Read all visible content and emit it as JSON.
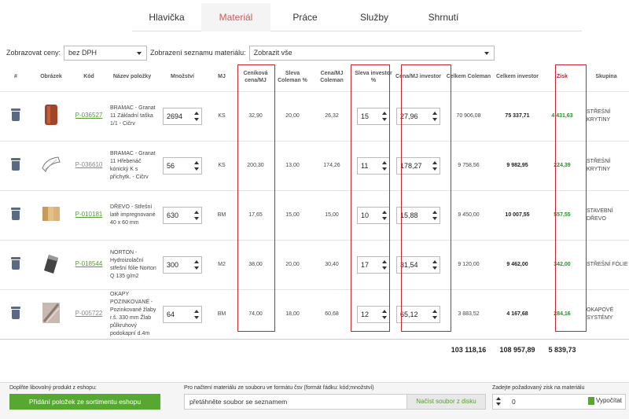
{
  "tabs": [
    "Hlavička",
    "Materiál",
    "Práce",
    "Služby",
    "Shrnutí"
  ],
  "active_tab": 1,
  "filters": {
    "price_label": "Zobrazovat ceny:",
    "price_value": "bez DPH",
    "list_label": "Zobrazení seznamu materiálu:",
    "list_value": "Zobrazit vše"
  },
  "columns": [
    "#",
    "Obrázek",
    "Kód",
    "Název položky",
    "Množství",
    "MJ",
    "Ceníková cena/MJ",
    "Sleva Coleman %",
    "Cena/MJ Coleman",
    "Sleva investor %",
    "Cena/MJ investor",
    "Celkem Coleman",
    "Celkem investor",
    "Zisk",
    "Skupina"
  ],
  "rows": [
    {
      "code": "P-036527",
      "code_grey": false,
      "name": "BRAMAC - Granat 11 Základní taška 1/1 - Cičrv",
      "qty": "2694",
      "unit": "KS",
      "list_price": "32,90",
      "disc_coleman": "20,00",
      "price_coleman": "26,32",
      "disc_investor": "15",
      "price_investor": "27,96",
      "total_coleman": "70 906,08",
      "total_investor": "75 337,71",
      "profit": "4 431,63",
      "group": "STŘEŠNÍ KRYTINY",
      "thumb": "roof-tile"
    },
    {
      "code": "P-036610",
      "code_grey": true,
      "name": "BRAMAC - Granat 11 Hřebenáč kónický K s příchytk. - Cičrv",
      "qty": "56",
      "unit": "KS",
      "list_price": "200,30",
      "disc_coleman": "13,00",
      "price_coleman": "174,26",
      "disc_investor": "11",
      "price_investor": "178,27",
      "total_coleman": "9 758,56",
      "total_investor": "9 982,95",
      "profit": "224,39",
      "group": "STŘEŠNÍ KRYTINY",
      "thumb": "ridge-tile"
    },
    {
      "code": "P-010181",
      "code_grey": false,
      "name": "DŘEVO - Střešní latě impregnované 40 x 60 mm",
      "qty": "630",
      "unit": "BM",
      "list_price": "17,65",
      "disc_coleman": "15,00",
      "price_coleman": "15,00",
      "disc_investor": "10",
      "price_investor": "15,88",
      "total_coleman": "9 450,00",
      "total_investor": "10 007,55",
      "profit": "557,55",
      "group": "STAVEBNÍ DŘEVO",
      "thumb": "wood"
    },
    {
      "code": "P-018544",
      "code_grey": false,
      "name": "NORTON - Hydroizolační střešní fólie Norton Q 135 g/m2",
      "qty": "300",
      "unit": "M2",
      "list_price": "38,00",
      "disc_coleman": "20,00",
      "price_coleman": "30,40",
      "disc_investor": "17",
      "price_investor": "31,54",
      "total_coleman": "9 120,00",
      "total_investor": "9 462,00",
      "profit": "342,00",
      "group": "STŘEŠNÍ FÓLIE",
      "thumb": "foil"
    },
    {
      "code": "P-005722",
      "code_grey": true,
      "name": "OKAPY POZINKOVANÉ - Pozinkované žlaby r.š. 330 mm Žlab půlkruhový podokapní d.4m",
      "qty": "64",
      "unit": "BM",
      "list_price": "74,00",
      "disc_coleman": "18,00",
      "price_coleman": "60,68",
      "disc_investor": "12",
      "price_investor": "65,12",
      "total_coleman": "3 883,52",
      "total_investor": "4 167,68",
      "profit": "284,16",
      "group": "OKAPOVÉ SYSTÉMY",
      "thumb": "gutter"
    }
  ],
  "totals": {
    "coleman": "103 118,16",
    "investor": "108 957,89",
    "profit": "5 839,73"
  },
  "bottom": {
    "add_label": "Doplňte libovolný produkt z eshopu:",
    "add_button": "Přidání položek ze sortimentu eshopu",
    "file_label": "Pro načtení materiálu ze souboru ve formátu čsv (formát řádku: kód;množství)",
    "file_placeholder": "přetáhněte soubor se seznamem",
    "load_button": "Načíst soubor z disku",
    "profit_label": "Zadejte požadovaný zisk na materiálu",
    "profit_value": "0",
    "calc_button": "Vypočítat"
  },
  "colors": {
    "accent": "#d05a5a",
    "green": "#56a830",
    "highlight": "#c0282d"
  }
}
